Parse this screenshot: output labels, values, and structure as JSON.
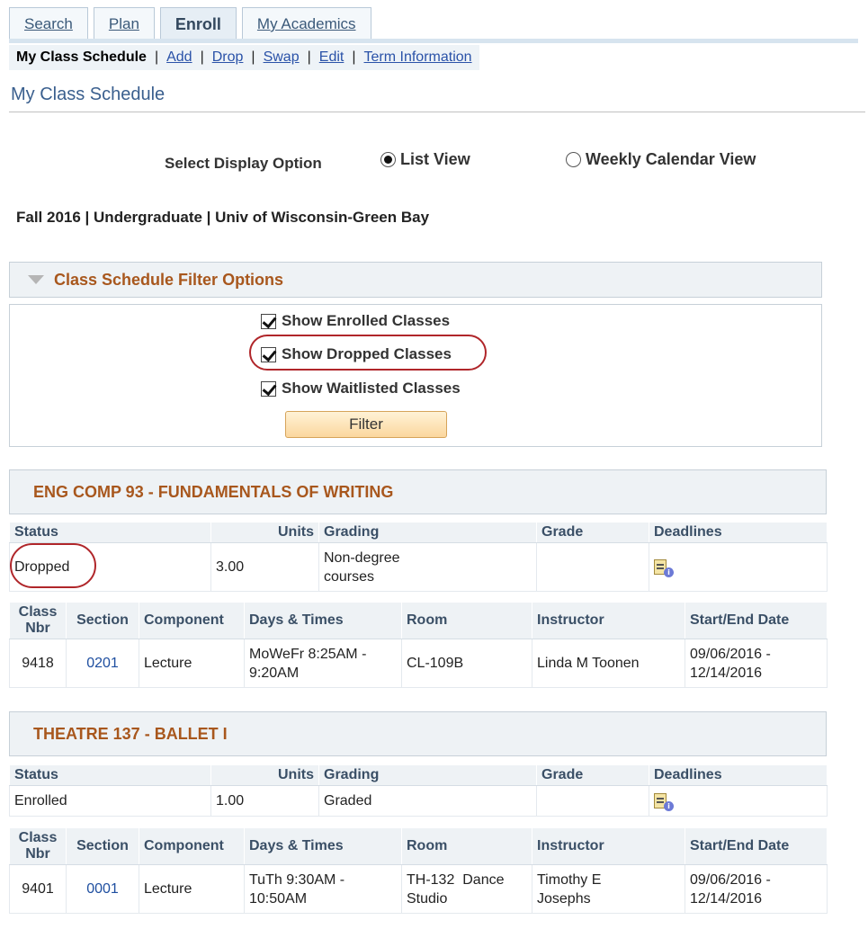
{
  "tabs": [
    {
      "label": "Search",
      "active": false
    },
    {
      "label": "Plan",
      "active": false
    },
    {
      "label": "Enroll",
      "active": true
    },
    {
      "label": "My Academics",
      "active": false
    }
  ],
  "subnav": {
    "current": "My Class Schedule",
    "links": [
      "Add",
      "Drop",
      "Swap",
      "Edit",
      "Term Information"
    ]
  },
  "page_title": "My Class Schedule",
  "display_options": {
    "label": "Select Display Option",
    "list_view": "List View",
    "weekly_view": "Weekly Calendar View",
    "selected": "List View"
  },
  "term": "Fall 2016 | Undergraduate | Univ of Wisconsin-Green Bay",
  "filter": {
    "header": "Class Schedule Filter Options",
    "enrolled": "Show Enrolled Classes",
    "dropped": "Show Dropped Classes",
    "waitlisted": "Show Waitlisted Classes",
    "button": "Filter"
  },
  "headers": {
    "status": "Status",
    "units": "Units",
    "grading": "Grading",
    "grade": "Grade",
    "deadlines": "Deadlines",
    "class_nbr_1": "Class",
    "class_nbr_2": "Nbr",
    "section": "Section",
    "component": "Component",
    "days_times": "Days & Times",
    "room": "Room",
    "instructor": "Instructor",
    "start_end": "Start/End Date"
  },
  "classes": [
    {
      "title": "ENG COMP 93 - FUNDAMENTALS OF WRITING",
      "status": "Dropped",
      "units": "3.00",
      "grading_1": "Non-degree",
      "grading_2": "courses",
      "grade": "",
      "class_nbr": "9418",
      "section": "0201",
      "component": "Lecture",
      "days_1": "MoWeFr 8:25AM -",
      "days_2": "9:20AM",
      "room_1": "CL-109B",
      "room_2": "",
      "instructor_1": "Linda M Toonen",
      "instructor_2": "",
      "date_1": "09/06/2016 -",
      "date_2": "12/14/2016"
    },
    {
      "title": "THEATRE 137 - BALLET I",
      "status": "Enrolled",
      "units": "1.00",
      "grading_1": "Graded",
      "grading_2": "",
      "grade": "",
      "class_nbr": "9401",
      "section": "0001",
      "component": "Lecture",
      "days_1": "TuTh 9:30AM -",
      "days_2": "10:50AM",
      "room_1": "TH-132  Dance",
      "room_2": "Studio",
      "instructor_1": "Timothy E",
      "instructor_2": "Josephs",
      "date_1": "09/06/2016 -",
      "date_2": "12/14/2016"
    }
  ]
}
